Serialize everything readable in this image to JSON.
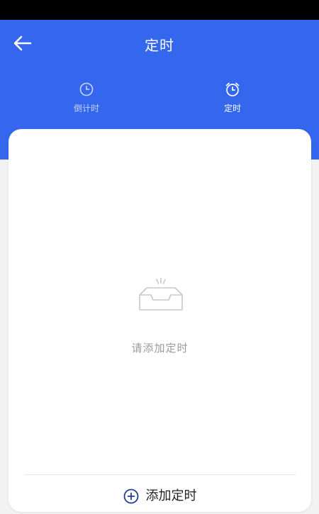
{
  "header": {
    "title": "定时",
    "back_icon": "arrow-left-icon",
    "background_color": "#3466ee"
  },
  "tabs": [
    {
      "label": "倒计时",
      "icon": "clock-icon",
      "active": false
    },
    {
      "label": "定时",
      "icon": "alarm-clock-icon",
      "active": true
    }
  ],
  "empty_state": {
    "icon": "empty-inbox-icon",
    "message": "请添加定时"
  },
  "footer": {
    "add_label": "添加定时",
    "add_icon": "plus-circle-icon"
  }
}
